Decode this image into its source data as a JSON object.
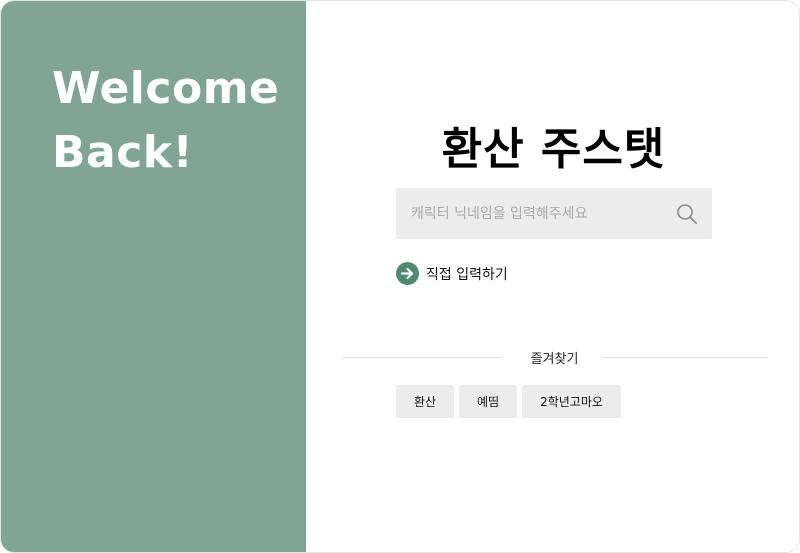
{
  "sidebar": {
    "welcome_line1": "Welcome",
    "welcome_line2": "Back!",
    "background_color": "#80a595"
  },
  "main": {
    "title": "환산 주스탯",
    "search": {
      "placeholder": "캐릭터 닉네임을 입력해주세요",
      "value": "",
      "icon": "search-icon"
    },
    "direct_input": {
      "label": "직접 입력하기",
      "icon": "arrow-right-circle-icon",
      "accent_color": "#4f8a6f"
    },
    "favorites": {
      "label": "즐겨찾기",
      "items": [
        "환산",
        "예띰",
        "2학년고마오"
      ]
    }
  }
}
